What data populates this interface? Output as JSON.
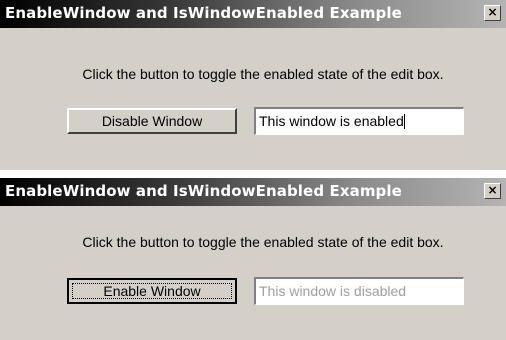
{
  "windows": [
    {
      "title": "EnableWindow and IsWindowEnabled Example",
      "instructions": "Click the button to toggle the enabled state of the edit box.",
      "button_label": "Disable Window",
      "edit_value": "This window is enabled",
      "edit_enabled": true
    },
    {
      "title": "EnableWindow and IsWindowEnabled Example",
      "instructions": "Click the button to toggle the enabled state of the edit box.",
      "button_label": "Enable Window",
      "edit_value": "This window is disabled",
      "edit_enabled": false
    }
  ],
  "close_glyph": "×",
  "colors": {
    "dialog_face": "#d4d0c8",
    "disabled_text": "#a0a0a0"
  }
}
